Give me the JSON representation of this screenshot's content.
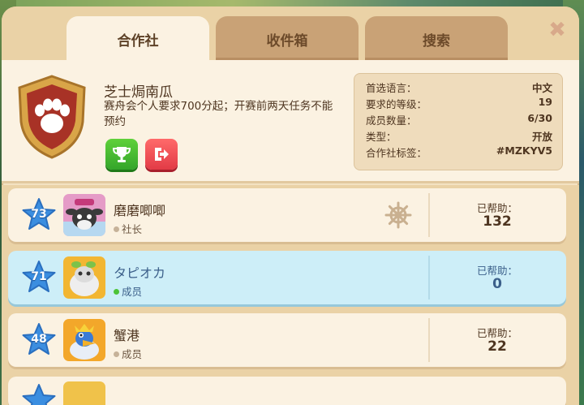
{
  "tabs": [
    {
      "label": "合作社",
      "active": true
    },
    {
      "label": "收件箱",
      "active": false
    },
    {
      "label": "搜索",
      "active": false
    }
  ],
  "close_icon": "close-x-icon",
  "club": {
    "name": "芝士焗南瓜",
    "description": "赛舟会个人要求700分起；开赛前两天任务不能预约",
    "emblem_icon": "paw-shield-icon",
    "details": [
      {
        "label": "首选语言：",
        "value": "中文"
      },
      {
        "label": "要求的等级：",
        "value": "19"
      },
      {
        "label": "成员数量：",
        "value": "6/30"
      },
      {
        "label": "类型：",
        "value": "开放"
      },
      {
        "label": "合作社标签：",
        "value": "#MZKYV5"
      }
    ]
  },
  "members": [
    {
      "level": "73",
      "name": "磨磨唧唧",
      "role": "社长",
      "helped_label": "已帮助：",
      "helped": "132",
      "highlight": false,
      "online": false
    },
    {
      "level": "71",
      "name": "タピオカ",
      "role": "成员",
      "helped_label": "已帮助：",
      "helped": "0",
      "highlight": true,
      "online": true
    },
    {
      "level": "48",
      "name": "蟹港",
      "role": "成员",
      "helped_label": "已帮助：",
      "helped": "22",
      "highlight": false,
      "online": false
    }
  ],
  "colors": {
    "panel": "#f3e2c2",
    "tab_inactive": "#c9a276",
    "highlight_row": "#cdeef8",
    "trophy_button": "#34a52a",
    "leave_button": "#e23b46",
    "level_star": "#3b8ee0"
  }
}
